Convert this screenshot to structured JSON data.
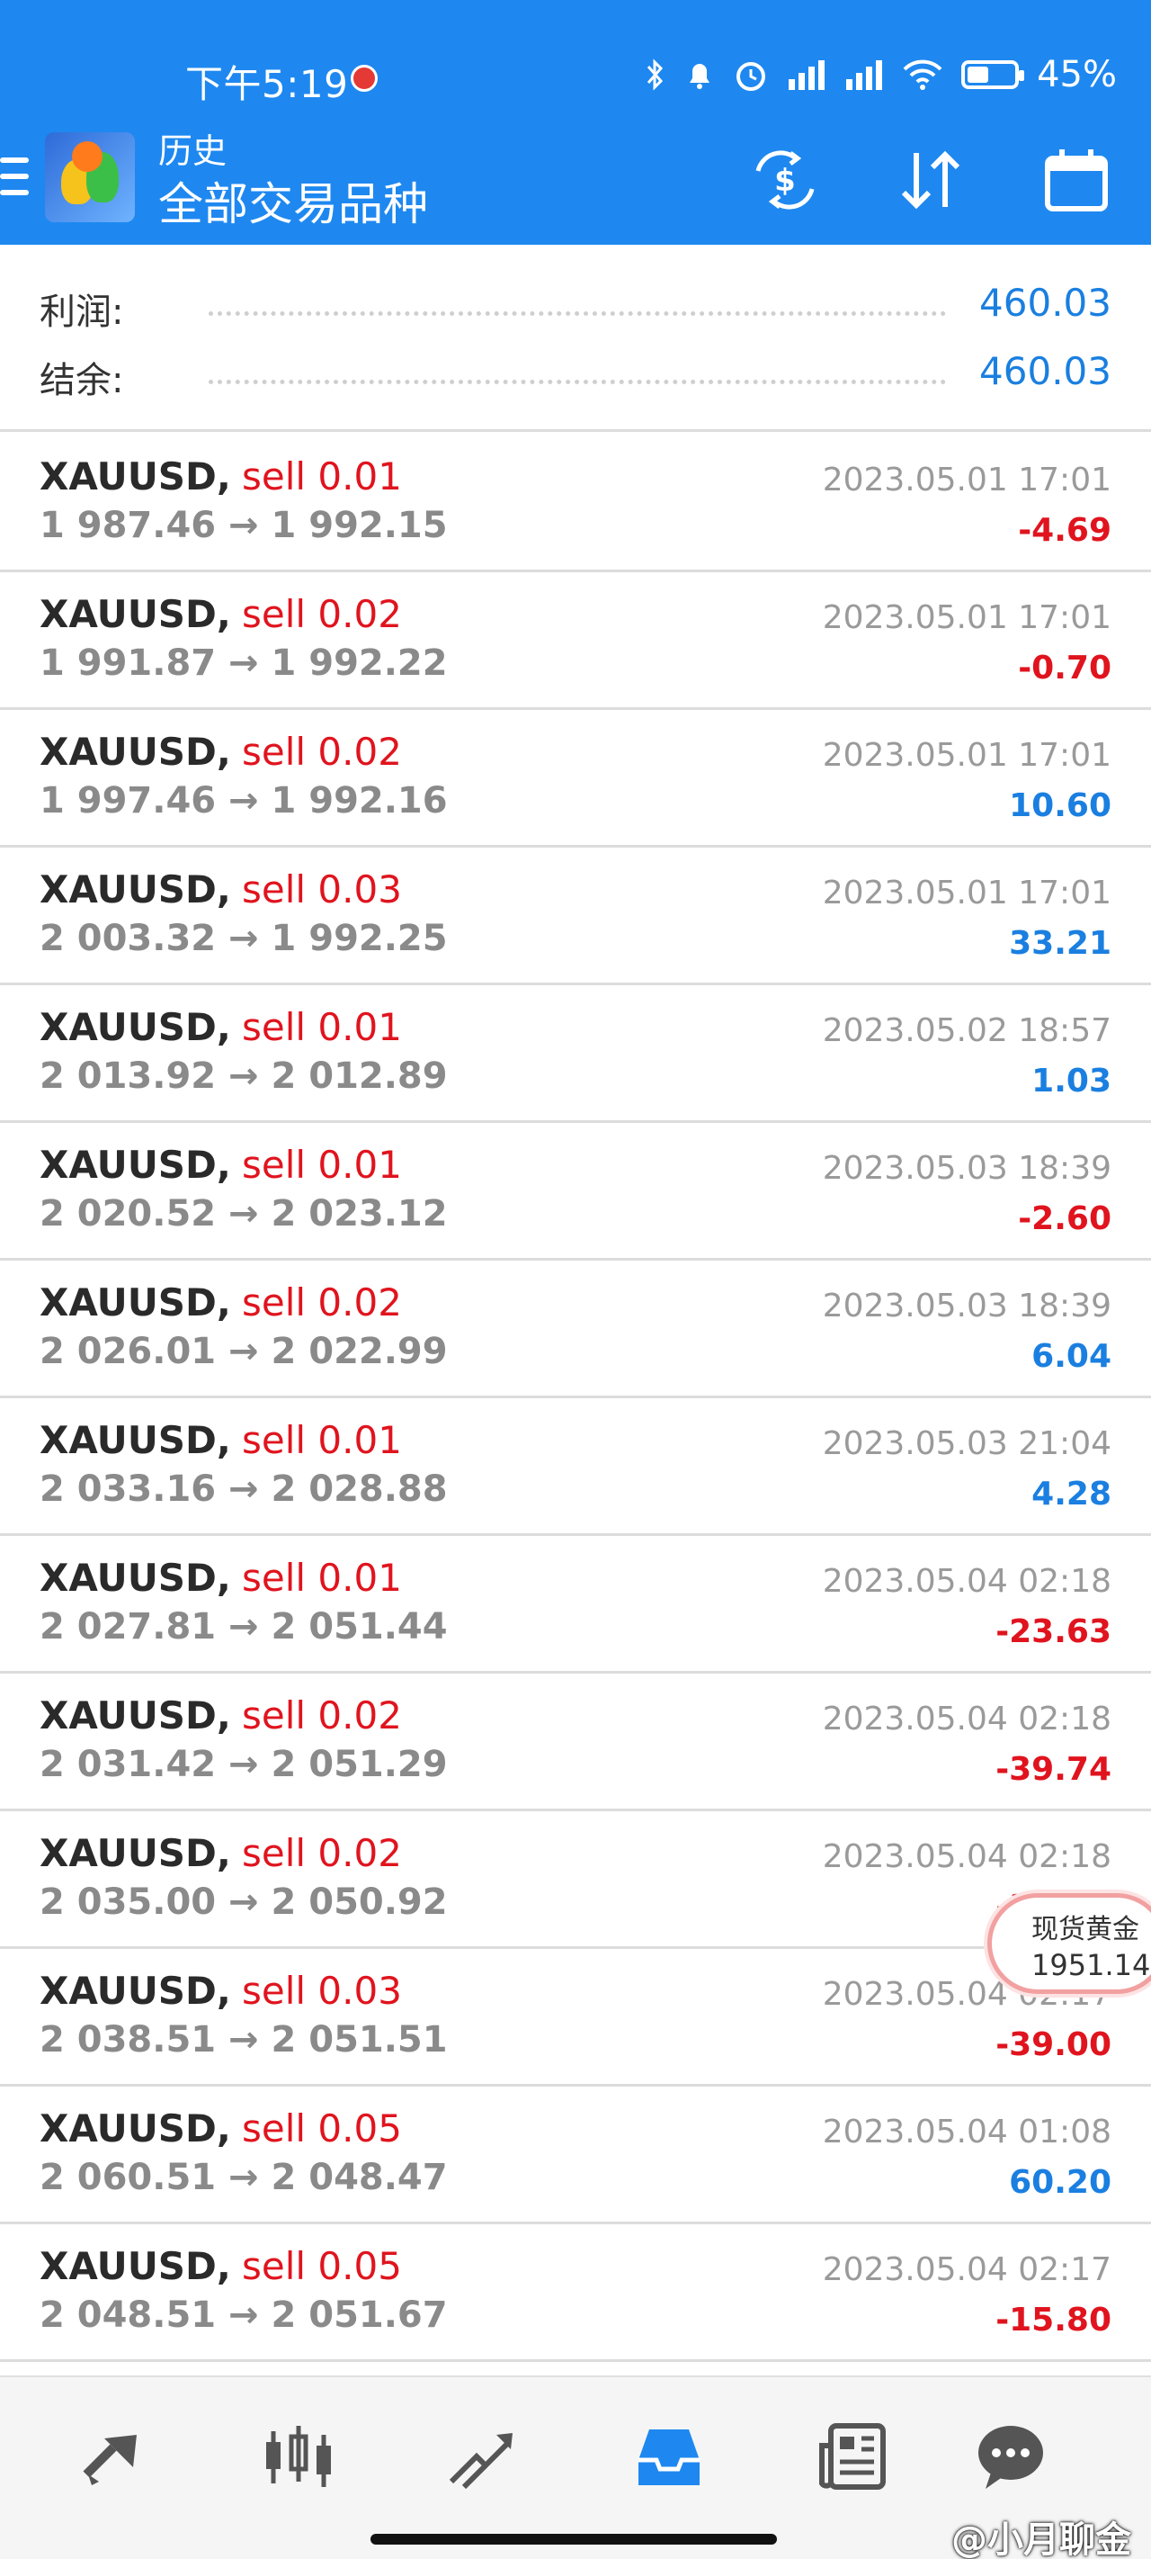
{
  "status_bar": {
    "time": "下午5:19",
    "battery_percent": "45%",
    "battery_level": 0.45
  },
  "header": {
    "subtitle": "历史",
    "title": "全部交易品种",
    "accent_color": "#1E88F0"
  },
  "summary": {
    "profit_label": "利润:",
    "profit_value": "460.03",
    "balance_label": "结余:",
    "balance_value": "460.03"
  },
  "trades": [
    {
      "symbol": "XAUUSD,",
      "side": "sell 0.01",
      "prices": "1 987.46 → 1 992.15",
      "time": "2023.05.01 17:01",
      "profit": "-4.69",
      "sign": "neg"
    },
    {
      "symbol": "XAUUSD,",
      "side": "sell 0.02",
      "prices": "1 991.87 → 1 992.22",
      "time": "2023.05.01 17:01",
      "profit": "-0.70",
      "sign": "neg"
    },
    {
      "symbol": "XAUUSD,",
      "side": "sell 0.02",
      "prices": "1 997.46 → 1 992.16",
      "time": "2023.05.01 17:01",
      "profit": "10.60",
      "sign": "pos"
    },
    {
      "symbol": "XAUUSD,",
      "side": "sell 0.03",
      "prices": "2 003.32 → 1 992.25",
      "time": "2023.05.01 17:01",
      "profit": "33.21",
      "sign": "pos"
    },
    {
      "symbol": "XAUUSD,",
      "side": "sell 0.01",
      "prices": "2 013.92 → 2 012.89",
      "time": "2023.05.02 18:57",
      "profit": "1.03",
      "sign": "pos"
    },
    {
      "symbol": "XAUUSD,",
      "side": "sell 0.01",
      "prices": "2 020.52 → 2 023.12",
      "time": "2023.05.03 18:39",
      "profit": "-2.60",
      "sign": "neg"
    },
    {
      "symbol": "XAUUSD,",
      "side": "sell 0.02",
      "prices": "2 026.01 → 2 022.99",
      "time": "2023.05.03 18:39",
      "profit": "6.04",
      "sign": "pos"
    },
    {
      "symbol": "XAUUSD,",
      "side": "sell 0.01",
      "prices": "2 033.16 → 2 028.88",
      "time": "2023.05.03 21:04",
      "profit": "4.28",
      "sign": "pos"
    },
    {
      "symbol": "XAUUSD,",
      "side": "sell 0.01",
      "prices": "2 027.81 → 2 051.44",
      "time": "2023.05.04 02:18",
      "profit": "-23.63",
      "sign": "neg"
    },
    {
      "symbol": "XAUUSD,",
      "side": "sell 0.02",
      "prices": "2 031.42 → 2 051.29",
      "time": "2023.05.04 02:18",
      "profit": "-39.74",
      "sign": "neg"
    },
    {
      "symbol": "XAUUSD,",
      "side": "sell 0.02",
      "prices": "2 035.00 → 2 050.92",
      "time": "2023.05.04 02:18",
      "profit": "-31.84",
      "sign": "neg"
    },
    {
      "symbol": "XAUUSD,",
      "side": "sell 0.03",
      "prices": "2 038.51 → 2 051.51",
      "time": "2023.05.04 02:17",
      "profit": "-39.00",
      "sign": "neg"
    },
    {
      "symbol": "XAUUSD,",
      "side": "sell 0.05",
      "prices": "2 060.51 → 2 048.47",
      "time": "2023.05.04 01:08",
      "profit": "60.20",
      "sign": "pos"
    },
    {
      "symbol": "XAUUSD,",
      "side": "sell 0.05",
      "prices": "2 048.51 → 2 051.67",
      "time": "2023.05.04 02:17",
      "profit": "-15.80",
      "sign": "neg"
    }
  ],
  "price_badge": {
    "name": "现货黄金",
    "price": "1951.14"
  },
  "bottom_nav": {
    "items": [
      "quotes-icon",
      "chart-candles-icon",
      "trade-icon",
      "history-inbox-icon",
      "news-icon",
      "chat-icon"
    ],
    "active_index": 3,
    "active_color": "#1E88F0"
  },
  "watermark": "@小月聊金",
  "colors": {
    "profit_positive": "#1a7fe0",
    "profit_negative": "#e0141e",
    "sell_label": "#e0141e"
  }
}
